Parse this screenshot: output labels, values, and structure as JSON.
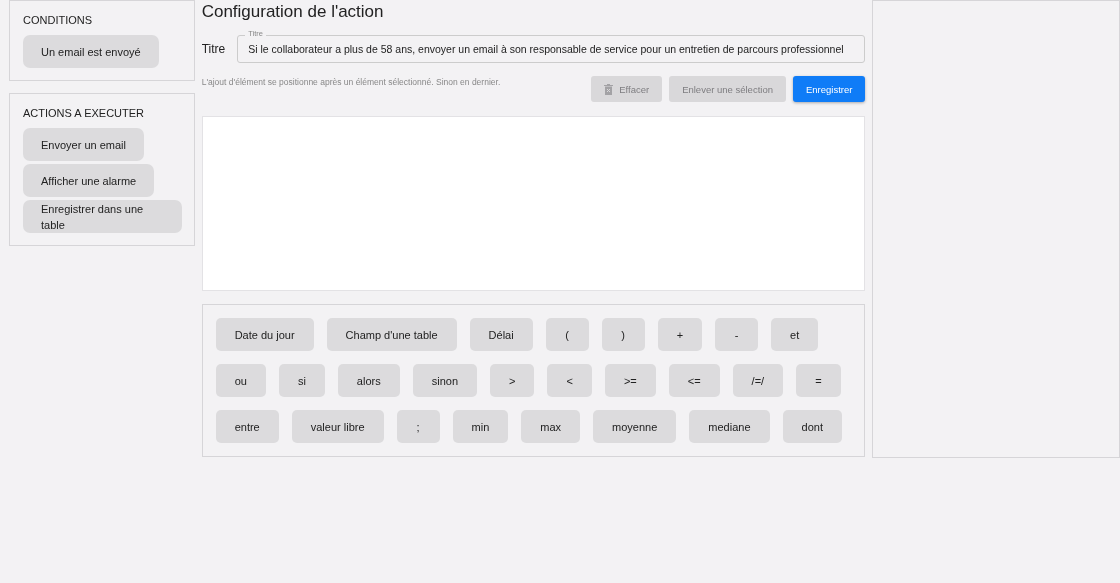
{
  "sidebar": {
    "sections": [
      {
        "title": "CONDITIONS",
        "items": [
          "Un email est envoyé"
        ]
      },
      {
        "title": "ACTIONS A EXECUTER",
        "items": [
          "Envoyer un email",
          "Afficher une alarme",
          "Enregistrer dans une table"
        ]
      }
    ]
  },
  "editor": {
    "title": "Configuration de l'action",
    "title_field": {
      "label": "Titre",
      "floating_label": "Titre",
      "value": "Si le collaborateur a plus de 58 ans, envoyer un email à son responsable de service pour un entretien de parcours professionnel"
    },
    "hint": "L'ajout d'élément se positionne après un élément sélectionné. Sinon en dernier.",
    "buttons": [
      {
        "label": "Effacer",
        "kind": "delete",
        "disabled": true
      },
      {
        "label": "Enlever une sélection",
        "kind": "plain",
        "disabled": true
      },
      {
        "label": "Enregistrer",
        "kind": "primary",
        "disabled": false
      }
    ],
    "token_rows": [
      [
        "Date du jour",
        "Champ d'une table",
        "Délai",
        "(",
        ")",
        "+",
        "-",
        "et"
      ],
      [
        "ou",
        "si",
        "alors",
        "sinon",
        ">",
        "<",
        ">=",
        "<=",
        "/=/",
        "="
      ],
      [
        "entre",
        "valeur libre",
        ";",
        "min",
        "max",
        "moyenne",
        "mediane",
        "dont"
      ]
    ]
  }
}
